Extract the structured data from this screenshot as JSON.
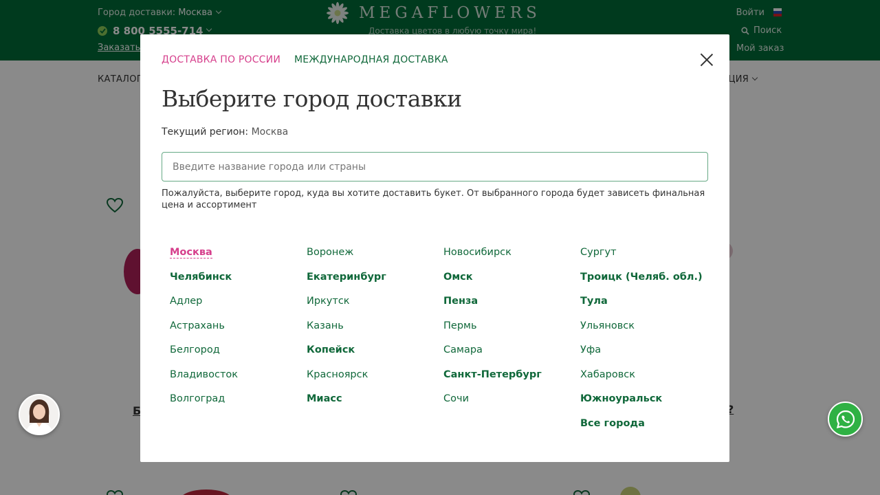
{
  "header": {
    "city_label": "Город доставки:",
    "city_value": "Москва",
    "phone": "8 800 5555-714",
    "order_call": "Заказать",
    "logo_text": "MEGAFLOWERS",
    "slogan": "Доставка цветов в любую точку мира!",
    "login": "Войти",
    "search": "Поиск",
    "my_order": "Мой заказ"
  },
  "nav": {
    "catalog": "КАТАЛОГ",
    "info": "ОРМАЦИЯ"
  },
  "background": {
    "product_partial_left": "Б",
    "product_partial_right": "?"
  },
  "modal": {
    "tab_russia": "ДОСТАВКА ПО РОССИИ",
    "tab_international": "МЕЖДУНАРОДНАЯ ДОСТАВКА",
    "title": "Выберите город доставки",
    "region_label": "Текущий регион:",
    "region_value": "Москва",
    "search_placeholder": "Введите название города или страны",
    "hint": "Пожалуйста, выберите город, куда вы хотите доставить букет. От выбранного города будет зависеть финальная цена и ассортимент",
    "columns": [
      [
        {
          "name": "Москва",
          "style": "current"
        },
        {
          "name": "Челябинск",
          "style": "bold"
        },
        {
          "name": "Адлер",
          "style": "normal"
        },
        {
          "name": "Астрахань",
          "style": "normal"
        },
        {
          "name": "Белгород",
          "style": "normal"
        },
        {
          "name": "Владивосток",
          "style": "normal"
        },
        {
          "name": "Волгоград",
          "style": "normal"
        }
      ],
      [
        {
          "name": "Воронеж",
          "style": "normal"
        },
        {
          "name": "Екатеринбург",
          "style": "bold"
        },
        {
          "name": "Иркутск",
          "style": "normal"
        },
        {
          "name": "Казань",
          "style": "normal"
        },
        {
          "name": "Копейск",
          "style": "bold"
        },
        {
          "name": "Красноярск",
          "style": "normal"
        },
        {
          "name": "Миасс",
          "style": "bold"
        }
      ],
      [
        {
          "name": "Новосибирск",
          "style": "normal"
        },
        {
          "name": "Омск",
          "style": "bold"
        },
        {
          "name": "Пенза",
          "style": "bold"
        },
        {
          "name": "Пермь",
          "style": "normal"
        },
        {
          "name": "Самара",
          "style": "normal"
        },
        {
          "name": "Санкт-Петербург",
          "style": "bold"
        },
        {
          "name": "Сочи",
          "style": "normal"
        }
      ],
      [
        {
          "name": "Сургут",
          "style": "normal"
        },
        {
          "name": "Троицк (Челяб. обл.)",
          "style": "bold"
        },
        {
          "name": "Тула",
          "style": "bold"
        },
        {
          "name": "Ульяновск",
          "style": "normal"
        },
        {
          "name": "Уфа",
          "style": "normal"
        },
        {
          "name": "Хабаровск",
          "style": "normal"
        },
        {
          "name": "Южноуральск",
          "style": "bold"
        },
        {
          "name": "Все города",
          "style": "bold"
        }
      ]
    ]
  },
  "colors": {
    "brand_green": "#006b38",
    "accent_pink": "#d63f8c",
    "link_green": "#10683a",
    "whatsapp_green": "#2fb144"
  },
  "icons": {
    "logo": "daisy-icon",
    "check": "check-circle-icon",
    "search": "magnifier-icon",
    "close": "close-icon",
    "favorite": "heart-icon",
    "chat": "whatsapp-icon"
  }
}
